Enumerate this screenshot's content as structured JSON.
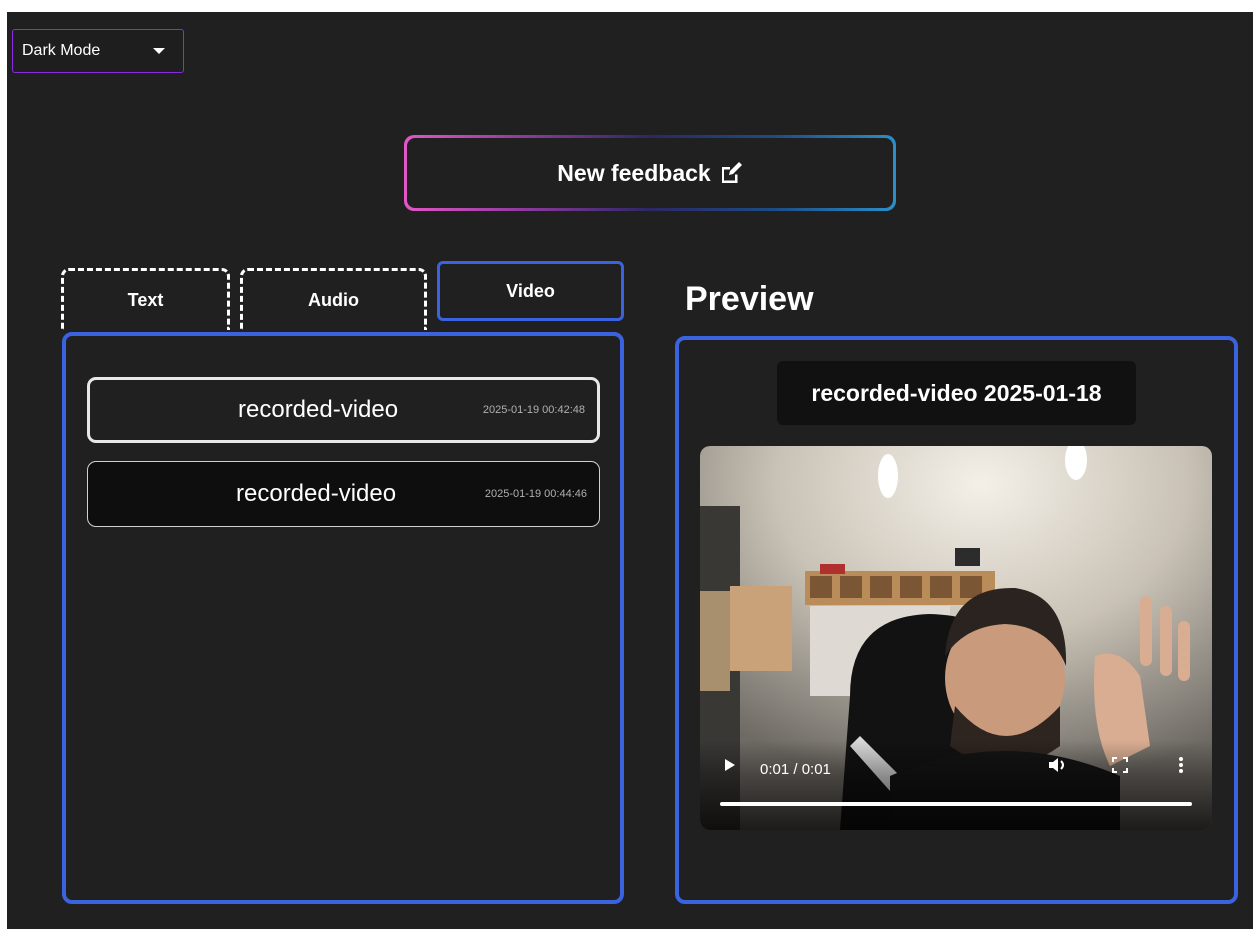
{
  "theme_select": {
    "value": "Dark Mode"
  },
  "new_feedback": {
    "label": "New feedback"
  },
  "tabs": [
    {
      "label": "Text",
      "state": "dashed"
    },
    {
      "label": "Audio",
      "state": "dashed"
    },
    {
      "label": "Video",
      "state": "active"
    }
  ],
  "recordings": [
    {
      "name": "recorded-video",
      "date": "2025-01-19 00:42:48",
      "selected": true
    },
    {
      "name": "recorded-video",
      "date": "2025-01-19 00:44:46",
      "selected": false
    }
  ],
  "preview": {
    "heading": "Preview",
    "video_title": "recorded-video 2025-01-18",
    "player": {
      "time": "0:01 / 0:01",
      "progress": 1.0
    }
  },
  "colors": {
    "background": "#202020",
    "accent_blue": "#3b63e0",
    "select_border": "#8a2be2",
    "gradient_start": "#e256c8",
    "gradient_end": "#2a8fc9"
  },
  "icons": [
    "caret-down-icon",
    "edit-icon",
    "play-icon",
    "volume-icon",
    "fullscreen-icon",
    "more-options-icon"
  ]
}
